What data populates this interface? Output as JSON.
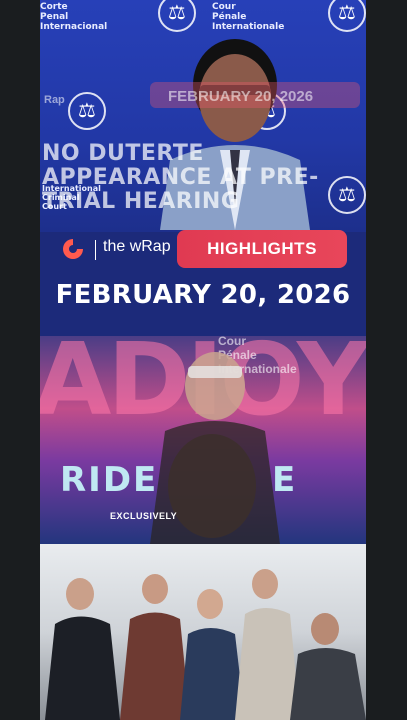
{
  "top_frame": {
    "icc_left_text": "Corte\nPenal\nInternacional",
    "icc_center_text": "Cour\nPénale\nInternationale",
    "ghost_rap_text": "Rap",
    "ghost_date": "FEBRUARY 20, 2026",
    "headline": "NO DUTERTE APPEARANCE AT PRE-TRIAL HEARING",
    "icc_small_text": "International\nCriminal\nCourt"
  },
  "brand": {
    "show_name": "the wRap",
    "highlights_label": "HIGHLIGHTS"
  },
  "date": "FEBRUARY 20, 2026",
  "poster": {
    "big_text": "ADIOY",
    "ride_text": "RIDE",
    "ride_text_end": "E",
    "exclusively": "EXCLUSIVELY",
    "cour_text": "Cour\nPénale\nInternationale"
  },
  "colors": {
    "highlights": "#e03a52",
    "background_blue": "#2238a6"
  }
}
